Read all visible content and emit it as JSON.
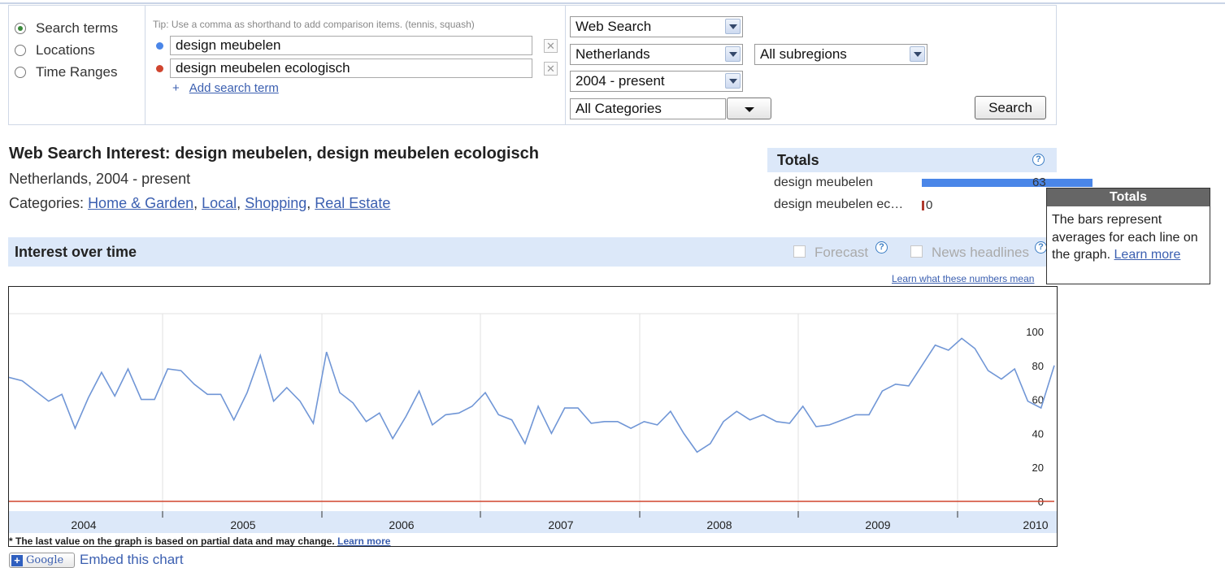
{
  "panel": {
    "radios": [
      {
        "label": "Search terms",
        "selected": true
      },
      {
        "label": "Locations",
        "selected": false
      },
      {
        "label": "Time Ranges",
        "selected": false
      }
    ],
    "tip": "Tip: Use a comma as shorthand to add comparison items. (tennis, squash)",
    "terms": [
      {
        "value": "design meubelen",
        "color": "#4a86e8"
      },
      {
        "value": "design meubelen ecologisch",
        "color": "#d0452f"
      }
    ],
    "remove_icon": "close-icon",
    "add_symbol": "+",
    "add_term_label": "Add search term",
    "selects": {
      "property": "Web Search",
      "country": "Netherlands",
      "subregion": "All subregions",
      "time": "2004 - present",
      "category": "All Categories"
    },
    "search_button": "Search"
  },
  "heading": {
    "title": "Web Search Interest: design meubelen, design meubelen ecologisch",
    "subtitle": "Netherlands, 2004 - present",
    "categories_prefix": "Categories: ",
    "categories": [
      "Home & Garden",
      "Local",
      "Shopping",
      "Real Estate"
    ]
  },
  "totals": {
    "title": "Totals",
    "rows": [
      {
        "label": "design meubelen",
        "value": "63",
        "fraction": 0.63
      },
      {
        "label": "design meubelen ec…",
        "value": "0",
        "fraction": 0
      }
    ]
  },
  "tooltip": {
    "title": "Totals",
    "text": "The bars represent averages for each line on the graph.",
    "link": "Learn more"
  },
  "interest": {
    "title": "Interest over time",
    "forecast_label": "Forecast",
    "news_label": "News headlines",
    "learn_numbers": "Learn what these numbers mean"
  },
  "chart_data": {
    "type": "line",
    "x_start": "2004-01",
    "x_step": "month",
    "x_tick_labels": [
      "2004",
      "2005",
      "2006",
      "2007",
      "2008",
      "2009",
      "2010"
    ],
    "y_tick_labels": [
      "100",
      "80",
      "60",
      "40",
      "20",
      "0"
    ],
    "ylim": [
      0,
      100
    ],
    "series": [
      {
        "color": "#7096d6",
        "values": [
          73,
          71,
          65,
          59,
          63,
          43,
          61,
          76,
          62,
          78,
          60,
          60,
          78,
          77,
          69,
          63,
          63,
          48,
          64,
          86,
          59,
          67,
          59,
          46,
          88,
          64,
          58,
          47,
          52,
          37,
          50,
          65,
          45,
          51,
          52,
          56,
          64,
          51,
          48,
          34,
          56,
          40,
          55,
          55,
          46,
          47,
          47,
          43,
          47,
          45,
          53,
          40,
          29,
          34,
          47,
          53,
          48,
          51,
          47,
          46,
          56,
          44,
          45,
          48,
          51,
          51,
          65,
          69,
          68,
          80,
          92,
          89,
          96,
          90,
          77,
          72,
          78,
          59,
          55,
          80
        ]
      },
      {
        "color": "#d0452f",
        "values": [
          0,
          0,
          0,
          0,
          0,
          0,
          0,
          0,
          0,
          0,
          0,
          0,
          0,
          0,
          0,
          0,
          0,
          0,
          0,
          0,
          0,
          0,
          0,
          0,
          0,
          0,
          0,
          0,
          0,
          0,
          0,
          0,
          0,
          0,
          0,
          0,
          0,
          0,
          0,
          0,
          0,
          0,
          0,
          0,
          0,
          0,
          0,
          0,
          0,
          0,
          0,
          0,
          0,
          0,
          0,
          0,
          0,
          0,
          0,
          0,
          0,
          0,
          0,
          0,
          0,
          0,
          0,
          0,
          0,
          0,
          0,
          0,
          0,
          0,
          0,
          0,
          0,
          0,
          0,
          0
        ]
      }
    ],
    "note": "* The last value on the graph is based on partial data and may change.",
    "note_link": "Learn more"
  },
  "footer": {
    "google_button": "Google",
    "embed": "Embed this chart"
  }
}
